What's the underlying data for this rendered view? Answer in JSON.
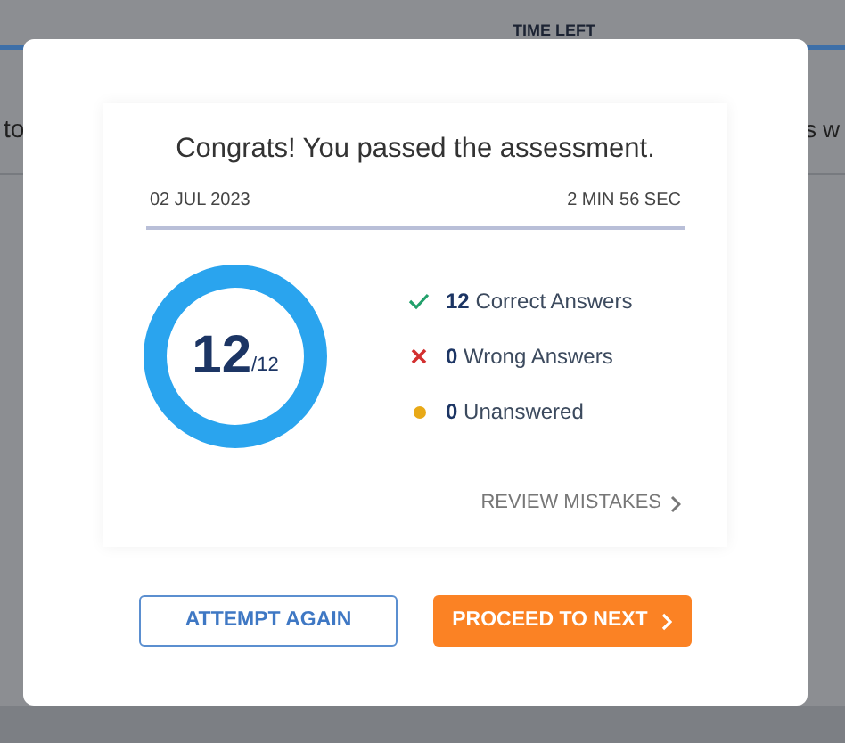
{
  "background": {
    "timer_label": "TIME LEFT",
    "left_text": "to",
    "right_text": "s w"
  },
  "result": {
    "title": "Congrats! You passed the assessment.",
    "date": "02 JUL 2023",
    "duration": "2 MIN 56 SEC",
    "score": {
      "value": "12",
      "total": "/12",
      "level": 1
    },
    "legend": [
      {
        "kind": "correct",
        "count": "12",
        "label": "Correct Answers"
      },
      {
        "kind": "wrong",
        "count": "0",
        "label": "Wrong Answers"
      },
      {
        "kind": "unanswered",
        "count": "0",
        "label": "Unanswered"
      }
    ],
    "review_link": "REVIEW MISTAKES"
  },
  "buttons": [
    {
      "kind": "secondary",
      "label": "ATTEMPT AGAIN"
    },
    {
      "kind": "primary",
      "label": "PROCEED TO NEXT"
    }
  ]
}
